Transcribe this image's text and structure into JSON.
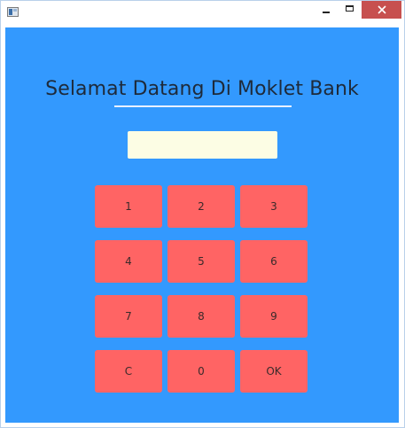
{
  "window": {
    "title": "",
    "controls": [
      "minimize-icon",
      "maximize-icon",
      "close-icon"
    ],
    "client_background": "#3399FE"
  },
  "header": {
    "title": "Selamat Datang Di Moklet Bank",
    "underline_color": "#E8F1FF"
  },
  "pin_input": {
    "value": "",
    "background": "#FCFDE4"
  },
  "keypad": {
    "button_color": "#FF6464",
    "keys": [
      "1",
      "2",
      "3",
      "4",
      "5",
      "6",
      "7",
      "8",
      "9",
      "C",
      "0",
      "OK"
    ]
  },
  "colors": {
    "close_button": "#C7504F"
  }
}
